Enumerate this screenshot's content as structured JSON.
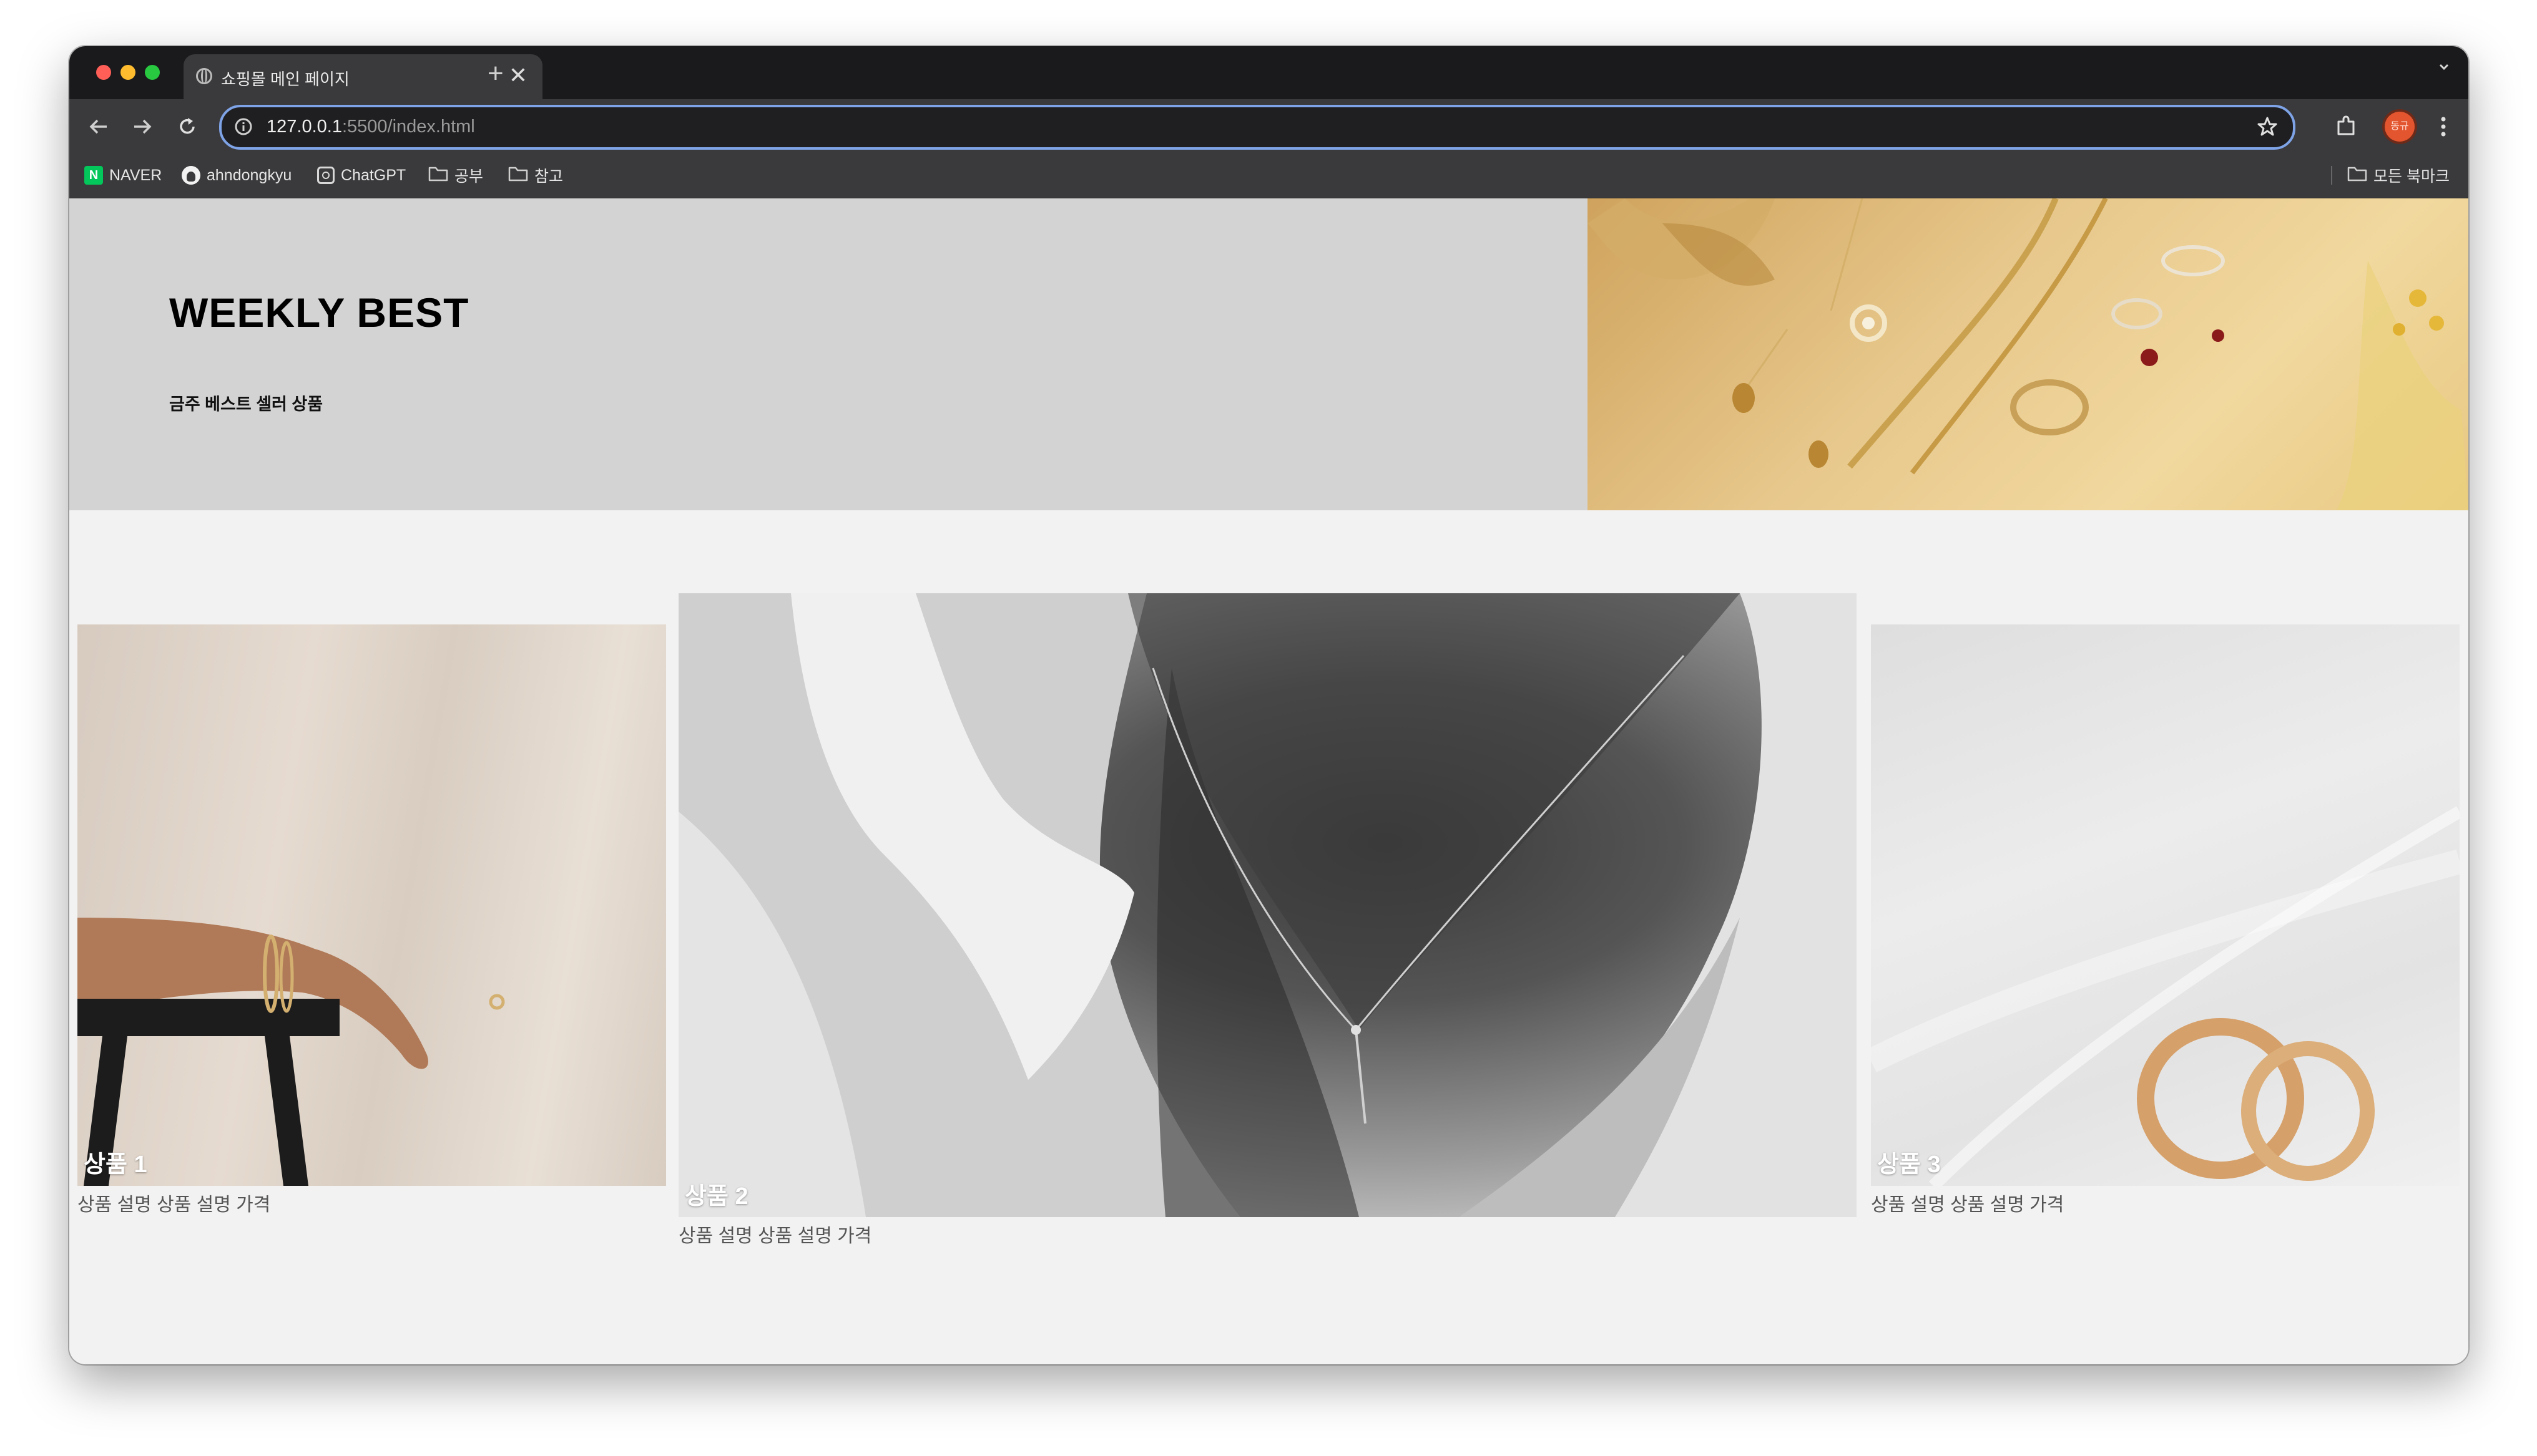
{
  "browser": {
    "tab_title": "쇼핑몰 메인 페이지",
    "tab_close": "✕",
    "new_tab": "+",
    "address_host": "127.0.0.1",
    "address_rest": ":5500/index.html",
    "profile_initials": "동규"
  },
  "bookmarks": {
    "items": [
      {
        "label": "NAVER",
        "icon": "naver-icon"
      },
      {
        "label": "ahndongkyu",
        "icon": "github-icon"
      },
      {
        "label": "ChatGPT",
        "icon": "chatgpt-icon"
      },
      {
        "label": "공부",
        "icon": "folder-icon"
      },
      {
        "label": "참고",
        "icon": "folder-icon"
      }
    ],
    "all_bookmarks": "모든 북마크"
  },
  "hero": {
    "title": "WEEKLY BEST",
    "subtitle": "금주 베스트 셀러 상품"
  },
  "products": [
    {
      "name": "상품 1",
      "desc": "상품 설명 상품 설명 가격"
    },
    {
      "name": "상품 2",
      "desc": "상품 설명 상품 설명 가격"
    },
    {
      "name": "상품 3",
      "desc": "상품 설명 상품 설명 가격"
    }
  ],
  "colors": {
    "hero_bg": "#d3d3d3",
    "page_bg": "#f2f2f2",
    "address_focus": "#7ea3e6",
    "naver_green": "#03c75a"
  }
}
